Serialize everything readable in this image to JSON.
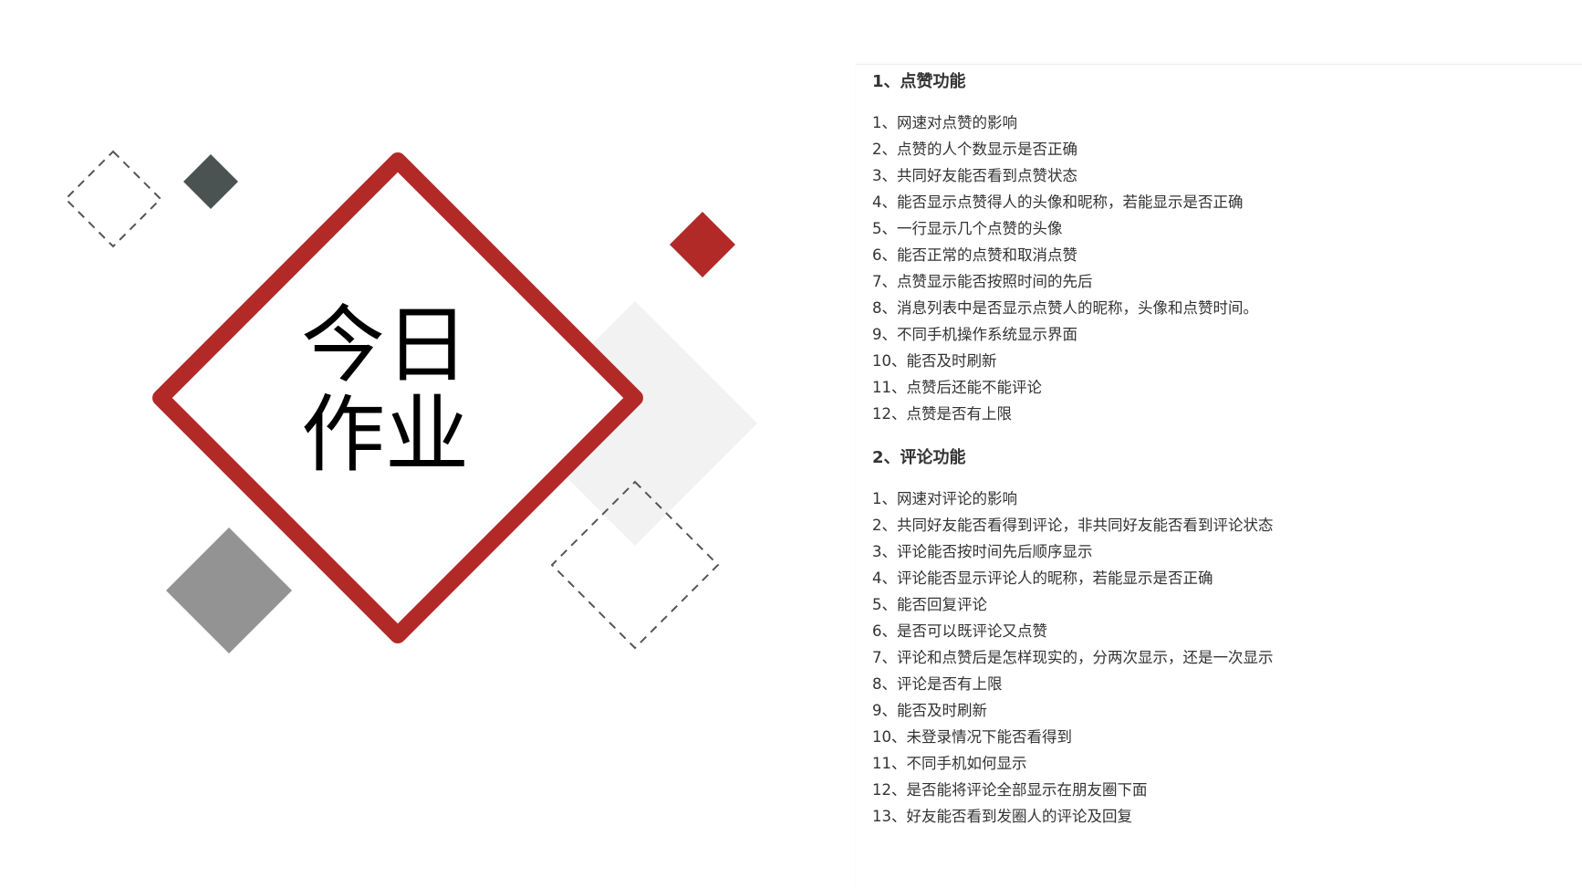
{
  "slide": {
    "title_line1": "今日",
    "title_line2": "作业"
  },
  "colors": {
    "accent_red": "#b22a28",
    "dark_gray": "#4a5352",
    "mid_gray": "#939393",
    "light_gray": "#f2f2f2",
    "dashed_gray": "#555555"
  },
  "section1": {
    "title": "1、点赞功能",
    "items": [
      "1、网速对点赞的影响",
      "2、点赞的人个数显示是否正确",
      "3、共同好友能否看到点赞状态",
      "4、能否显示点赞得人的头像和昵称，若能显示是否正确",
      "5、一行显示几个点赞的头像",
      "6、能否正常的点赞和取消点赞",
      "7、点赞显示能否按照时间的先后",
      "8、消息列表中是否显示点赞人的昵称，头像和点赞时间。",
      "9、不同手机操作系统显示界面",
      "10、能否及时刷新",
      "11、点赞后还能不能评论",
      "12、点赞是否有上限"
    ]
  },
  "section2": {
    "title": "2、评论功能",
    "items": [
      "1、网速对评论的影响",
      "2、共同好友能否看得到评论，非共同好友能否看到评论状态",
      "3、评论能否按时间先后顺序显示",
      "4、评论能否显示评论人的昵称，若能显示是否正确",
      "5、能否回复评论",
      "6、是否可以既评论又点赞",
      "7、评论和点赞后是怎样现实的，分两次显示，还是一次显示",
      "8、评论是否有上限",
      "9、能否及时刷新",
      "10、未登录情况下能否看得到",
      "11、不同手机如何显示",
      "12、是否能将评论全部显示在朋友圈下面",
      "13、好友能否看到发圈人的评论及回复"
    ]
  }
}
